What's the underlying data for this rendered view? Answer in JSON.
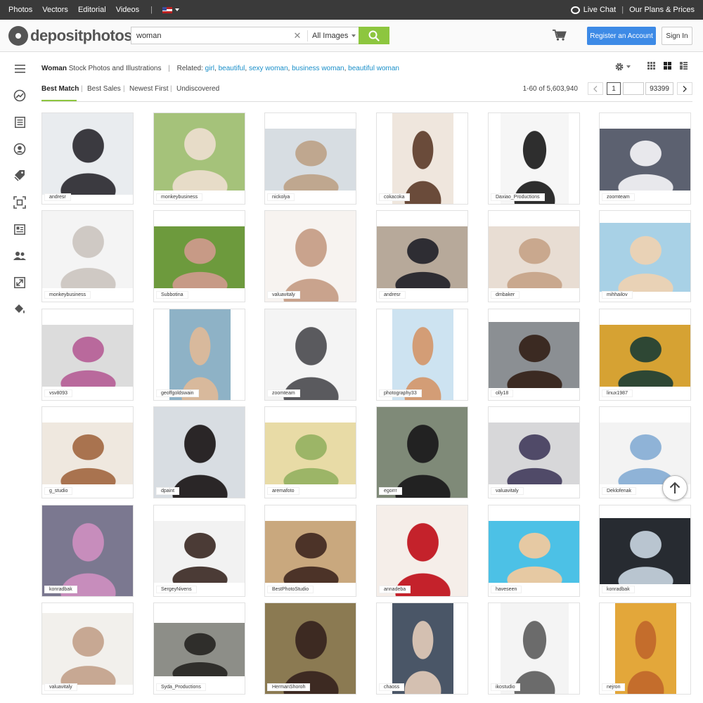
{
  "topbar": {
    "nav": [
      "Photos",
      "Vectors",
      "Editorial",
      "Videos"
    ],
    "separator": "|",
    "live_chat": "Live Chat",
    "plans": "Our Plans & Prices"
  },
  "header": {
    "logo_text": "depositphotos",
    "search_value": "woman",
    "search_scope": "All Images",
    "register_label": "Register an Account",
    "signin_label": "Sign In"
  },
  "breadcrumb": {
    "term": "Woman",
    "suffix": " Stock Photos and Illustrations",
    "related_label": "Related:",
    "related": [
      "girl",
      "beautiful",
      "sexy woman",
      "business woman",
      "beautiful woman"
    ]
  },
  "sort": {
    "tabs": [
      "Best Match",
      "Best Sales",
      "Newest First",
      "Undiscovered"
    ],
    "active": "Best Match",
    "results": "1-60 of 5,603,940",
    "page": "1",
    "total_pages": "93399"
  },
  "icons": {
    "sidebar": [
      "menu-icon",
      "trending-icon",
      "list-icon",
      "user-circle-icon",
      "tags-icon",
      "focus-icon",
      "news-icon",
      "people-icon",
      "expand-icon",
      "paint-bucket-icon"
    ]
  },
  "colors": {
    "accent_green": "#8dc63f",
    "register_blue": "#3d8ae6",
    "link_blue": "#1a8fc9",
    "topbar": "#3a3a3a"
  },
  "grid": [
    {
      "author": "andresr"
    },
    {
      "author": "monkeybusiness"
    },
    {
      "author": "nickolya"
    },
    {
      "author": "cokacoka"
    },
    {
      "author": "Daxiao_Productions"
    },
    {
      "author": "zoomteam"
    },
    {
      "author": "monkeybusiness"
    },
    {
      "author": "Subbotina"
    },
    {
      "author": "valuavitaly"
    },
    {
      "author": "andresr"
    },
    {
      "author": "dmbaker"
    },
    {
      "author": "mihhailov"
    },
    {
      "author": "vsv8093"
    },
    {
      "author": "geoffgoldswain"
    },
    {
      "author": "zoomteam"
    },
    {
      "author": "photography33"
    },
    {
      "author": "olly18"
    },
    {
      "author": "linux1987"
    },
    {
      "author": "g_studio"
    },
    {
      "author": "dpaint"
    },
    {
      "author": "aremafoto"
    },
    {
      "author": "egorrr"
    },
    {
      "author": "valuavitaly"
    },
    {
      "author": "Deklofenak"
    },
    {
      "author": "konradbak"
    },
    {
      "author": "SergeyNivens"
    },
    {
      "author": "BestPhotoStudio"
    },
    {
      "author": "annadeba"
    },
    {
      "author": "haveseen"
    },
    {
      "author": "konradbak"
    },
    {
      "author": "valuavitaly"
    },
    {
      "author": "Syda_Productions"
    },
    {
      "author": "HermanShoroh"
    },
    {
      "author": "chaoss"
    },
    {
      "author": "ikostudio"
    },
    {
      "author": "nejron"
    }
  ]
}
